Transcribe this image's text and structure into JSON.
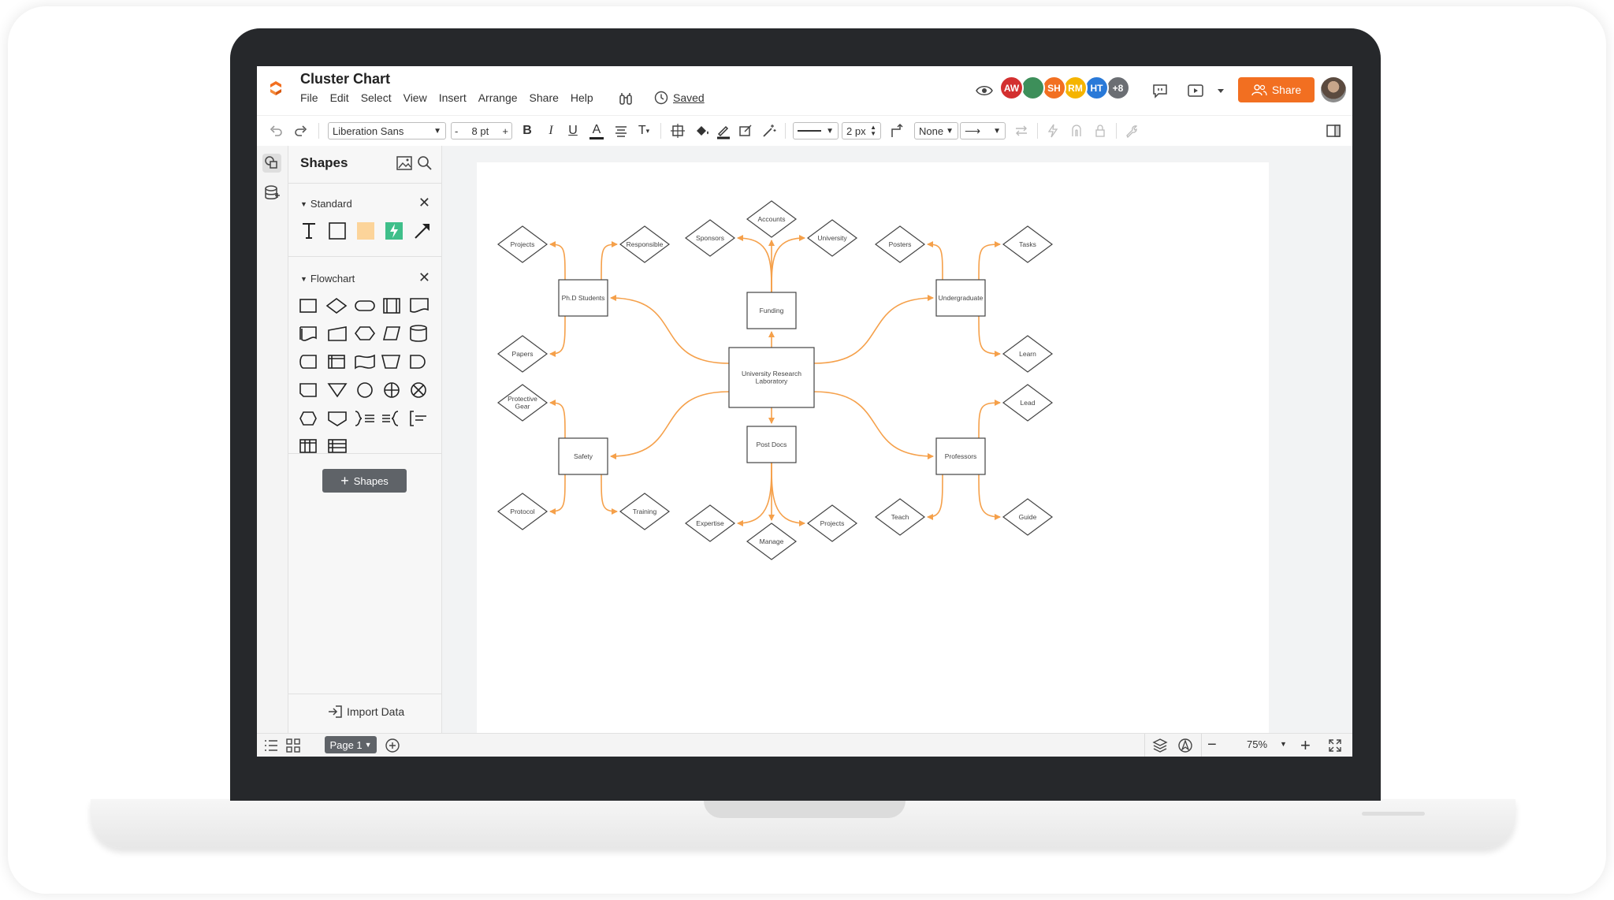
{
  "document": {
    "title": "Cluster Chart",
    "saved_label": "Saved"
  },
  "menu": [
    "File",
    "Edit",
    "Select",
    "View",
    "Insert",
    "Arrange",
    "Share",
    "Help"
  ],
  "collaborators": [
    {
      "initials": "AW",
      "color": "#d32f2f"
    },
    {
      "initials": "",
      "color": "#3d8f5a"
    },
    {
      "initials": "SH",
      "color": "#f26f21"
    },
    {
      "initials": "RM",
      "color": "#f5b400"
    },
    {
      "initials": "HT",
      "color": "#2979d8"
    },
    {
      "initials": "+8",
      "color": "#6b6e73"
    }
  ],
  "share_label": "Share",
  "toolbar": {
    "font_family": "Liberation Sans",
    "font_size": "8 pt",
    "minus": "-",
    "plus": "+",
    "bold": "B",
    "italic": "I",
    "underline": "U",
    "text_color": "A",
    "text_size": "T",
    "line_width": "2 px",
    "line_end": "None"
  },
  "shapes_panel": {
    "title": "Shapes",
    "sections": [
      "Standard",
      "Flowchart"
    ],
    "add_shapes_label": "Shapes",
    "import_label": "Import Data"
  },
  "diagram": {
    "center": "University Research Laboratory",
    "clusters": [
      {
        "hub": "Ph.D Students",
        "leaves": [
          "Projects",
          "Responsible",
          "Papers"
        ]
      },
      {
        "hub": "Funding",
        "leaves": [
          "Sponsors",
          "Accounts",
          "University"
        ]
      },
      {
        "hub": "Undergraduate",
        "leaves": [
          "Posters",
          "Tasks",
          "Learn"
        ]
      },
      {
        "hub": "Safety",
        "leaves": [
          "Protective Gear",
          "Protocol",
          "Training"
        ]
      },
      {
        "hub": "Post Docs",
        "leaves": [
          "Expertise",
          "Manage",
          "Projects"
        ]
      },
      {
        "hub": "Professors",
        "leaves": [
          "Lead",
          "Teach",
          "Guide"
        ]
      }
    ]
  },
  "bottombar": {
    "page_label": "Page 1",
    "zoom": "75%"
  },
  "colors": {
    "accent": "#f26f21",
    "connector": "#f5a04a"
  }
}
